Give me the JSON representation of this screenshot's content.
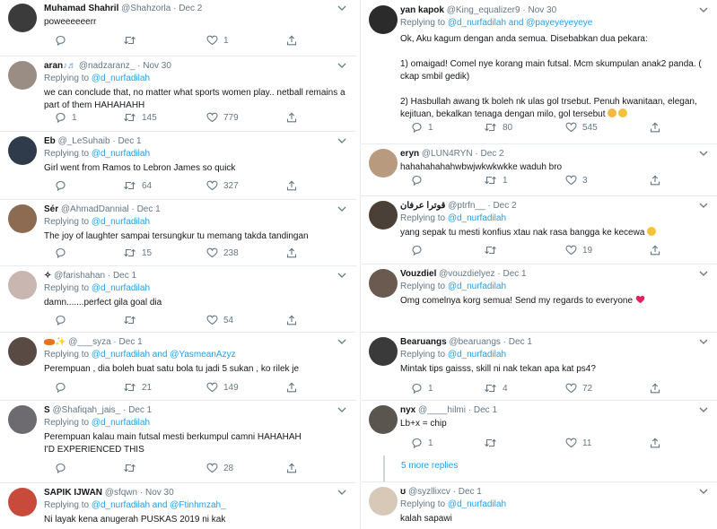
{
  "left": [
    {
      "name": "Muhamad Shahril",
      "handle": "@Shahzorla",
      "date": "Dec 2",
      "reply_to": "",
      "text": "poweeeeeerr",
      "replies": "",
      "retweets": "",
      "likes": "1",
      "avatar_color": "#3b3b3b"
    },
    {
      "name": "aran",
      "handle": "@nadzaranz_",
      "date": "Nov 30",
      "reply_to": "@d_nurfadilah",
      "text": "we can conclude that, no matter what sports women play.. netball remains a part of them HAHAHAHH",
      "replies": "1",
      "retweets": "145",
      "likes": "779",
      "avatar_color": "#9a8d84"
    },
    {
      "name": "Eb",
      "handle": "@_LeSuhaib",
      "date": "Dec 1",
      "reply_to": "@d_nurfadilah",
      "text": "Girl went from Ramos to  Lebron James so quick",
      "replies": "",
      "retweets": "64",
      "likes": "327",
      "avatar_color": "#2f3a4a"
    },
    {
      "name": "Sér",
      "handle": "@AhmadDannial",
      "date": "Dec 1",
      "reply_to": "@d_nurfadilah",
      "text": "The joy of laughter sampai tersungkur tu memang takda tandingan",
      "replies": "",
      "retweets": "15",
      "likes": "238",
      "avatar_color": "#8c6b52"
    },
    {
      "name": "✧",
      "handle": "@farishahan",
      "date": "Dec 1",
      "reply_to": "@d_nurfadilah",
      "text": "damn.......perfect gila goal dia",
      "replies": "",
      "retweets": "",
      "likes": "54",
      "avatar_color": "#c9b6b0"
    },
    {
      "name": "",
      "handle": "@___syza",
      "date": "Dec 1",
      "reply_to": "@d_nurfadilah and @YasmeanAzyz",
      "text": "Perempuan , dia boleh buat satu bola tu jadi 5 sukan , ko rilek je",
      "replies": "",
      "retweets": "21",
      "likes": "149",
      "avatar_color": "#5a4a44"
    },
    {
      "name": "S",
      "handle": "@Shafiqah_jais_",
      "date": "Dec 1",
      "reply_to": "@d_nurfadilah",
      "text": "Perempuan kalau main futsal mesti berkumpul camni HAHAHAH I'D EXPERIENCED THIS",
      "replies": "",
      "retweets": "",
      "likes": "28",
      "avatar_color": "#6d6a70"
    },
    {
      "name": "SAPIK IJWAN",
      "handle": "@sfqwn",
      "date": "Nov 30",
      "reply_to": "@d_nurfadilah and @Ftinhmzah_",
      "text": "Ni layak kena anugerah PUSKAS 2019 ni kak",
      "replies": "",
      "retweets": "",
      "likes": "",
      "avatar_color": "#c84a3a"
    }
  ],
  "right": [
    {
      "name": "yan kapok",
      "handle": "@King_equalizer9",
      "date": "Nov 30",
      "reply_to": "@d_nurfadilah and @payeyeyeyeye",
      "text": "Ok, Aku kagum dengan anda semua. Disebabkan dua pekara:\n\n1) omaigad!  Comel nye korang main futsal. Mcm skumpulan anak2 panda. ( ckap smbil gedik)\n\n2) Hasbullah awang tk boleh nk ulas gol trsebut. Penuh kwanitaan, elegan, kejituan, bekalkan tenaga dengan milo, gol tersebut",
      "replies": "1",
      "retweets": "80",
      "likes": "545",
      "avatar_color": "#2b2b2b"
    },
    {
      "name": "eryn",
      "handle": "@LUN4RYN",
      "date": "Dec 2",
      "reply_to": "",
      "text": "hahahahahahwbwjwkwkwkke waduh bro",
      "replies": "",
      "retweets": "1",
      "likes": "3",
      "avatar_color": "#b89a7e"
    },
    {
      "name": "قوترا عرفان",
      "handle": "@ptrfn__",
      "date": "Dec 2",
      "reply_to": "@d_nurfadilah",
      "text": "yang sepak tu mesti konfius xtau nak rasa bangga ke kecewa",
      "replies": "",
      "retweets": "",
      "likes": "19",
      "avatar_color": "#4a4038"
    },
    {
      "name": "Vouzdiel",
      "handle": "@vouzdielyez",
      "date": "Dec 1",
      "reply_to": "@d_nurfadilah",
      "text": "Omg comelnya korg semua! Send my regards to everyone",
      "replies": "",
      "retweets": "",
      "likes": "",
      "avatar_color": "#6a5a50"
    },
    {
      "name": "Bearuangs",
      "handle": "@bearuangs",
      "date": "Dec 1",
      "reply_to": "@d_nurfadilah",
      "text": "Mintak tips gaisss, skill ni nak tekan apa kat ps4?",
      "replies": "1",
      "retweets": "4",
      "likes": "72",
      "avatar_color": "#3a3a3a"
    },
    {
      "name": "nyx",
      "handle": "@____hilmi",
      "date": "Dec 1",
      "reply_to": "",
      "text": "Lb+x = chip",
      "replies": "1",
      "retweets": "",
      "likes": "11",
      "avatar_color": "#5b5550"
    },
    {
      "more": "5 more replies"
    },
    {
      "name": "ʊ",
      "handle": "@syzllixcv",
      "date": "Dec 1",
      "reply_to": "@d_nurfadilah",
      "text": "kalah sapawi",
      "replies": "",
      "retweets": "",
      "likes": "",
      "avatar_color": "#d8c8b8"
    }
  ],
  "ui": {
    "replying_prefix": "Replying to ",
    "dot": "·"
  },
  "colors": {
    "accent": "#1da1f2",
    "muted": "#657786",
    "border": "#e6ecf0",
    "heart": "#e0245e"
  }
}
